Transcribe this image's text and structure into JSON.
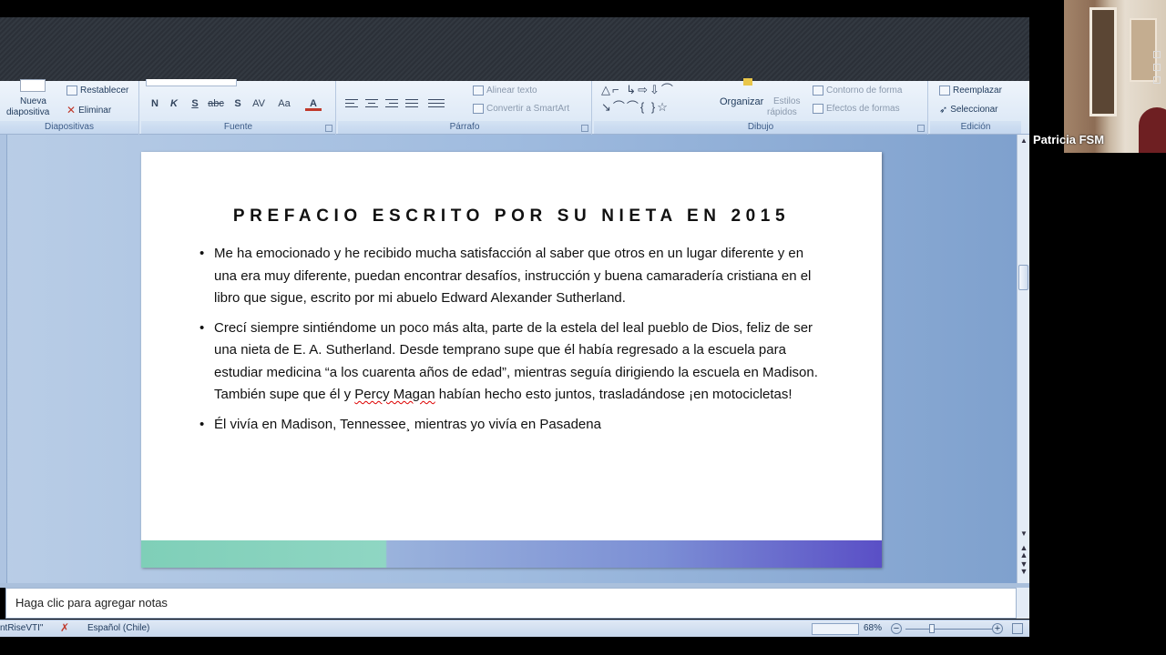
{
  "ribbon": {
    "diapositivas": {
      "label": "Diapositivas",
      "nueva_line1": "Nueva",
      "nueva_line2": "diapositiva",
      "restablecer": "Restablecer",
      "eliminar": "Eliminar"
    },
    "fuente": {
      "label": "Fuente",
      "bold": "N",
      "italic": "K",
      "underline": "S",
      "strike": "abc",
      "shadow": "S",
      "spacing": "AV",
      "case": "Aa",
      "color": "A"
    },
    "parrafo": {
      "label": "Párrafo",
      "alinear_texto": "Alinear texto",
      "convertir_smartart": "Convertir a SmartArt"
    },
    "dibujo": {
      "label": "Dibujo",
      "organizar": "Organizar",
      "estilos_line1": "Estilos",
      "estilos_line2": "rápidos",
      "contorno": "Contorno de forma",
      "efectos": "Efectos de formas"
    },
    "edicion": {
      "label": "Edición",
      "reemplazar": "Reemplazar",
      "seleccionar": "Seleccionar"
    }
  },
  "slide": {
    "title": "PREFACIO ESCRITO POR SU NIETA EN 2015",
    "bullet1": "Me ha emocionado y he recibido mucha satisfacción al saber que otros en un lugar diferente y en una era muy diferente, puedan encontrar desafíos, instrucción y buena camaradería cristiana en el libro que sigue, escrito por mi abuelo Edward Alexander Sutherland.",
    "bullet2_a": "Crecí siempre sintiéndome un poco más alta, parte de la estela del leal pueblo de Dios, feliz de ser una nieta de E. A. Sutherland. Desde temprano supe que él había regresado a la escuela para estudiar medicina “a los cuarenta años de edad”, mientras seguía dirigiendo la escuela en Madison. También supe que él y ",
    "bullet2_spell": "Percy Magan",
    "bullet2_b": " habían hecho esto juntos, trasladándose ¡en motocicletas!",
    "bullet3": "Él vivía en Madison, Tennessee¸ mientras yo vivía en Pasadena"
  },
  "notes": {
    "placeholder": "Haga clic para agregar notas"
  },
  "status": {
    "theme": "ntRiseVTI\"",
    "language": "Español (Chile)",
    "zoom": "68%"
  },
  "video": {
    "participant": "Patricia FSM"
  }
}
